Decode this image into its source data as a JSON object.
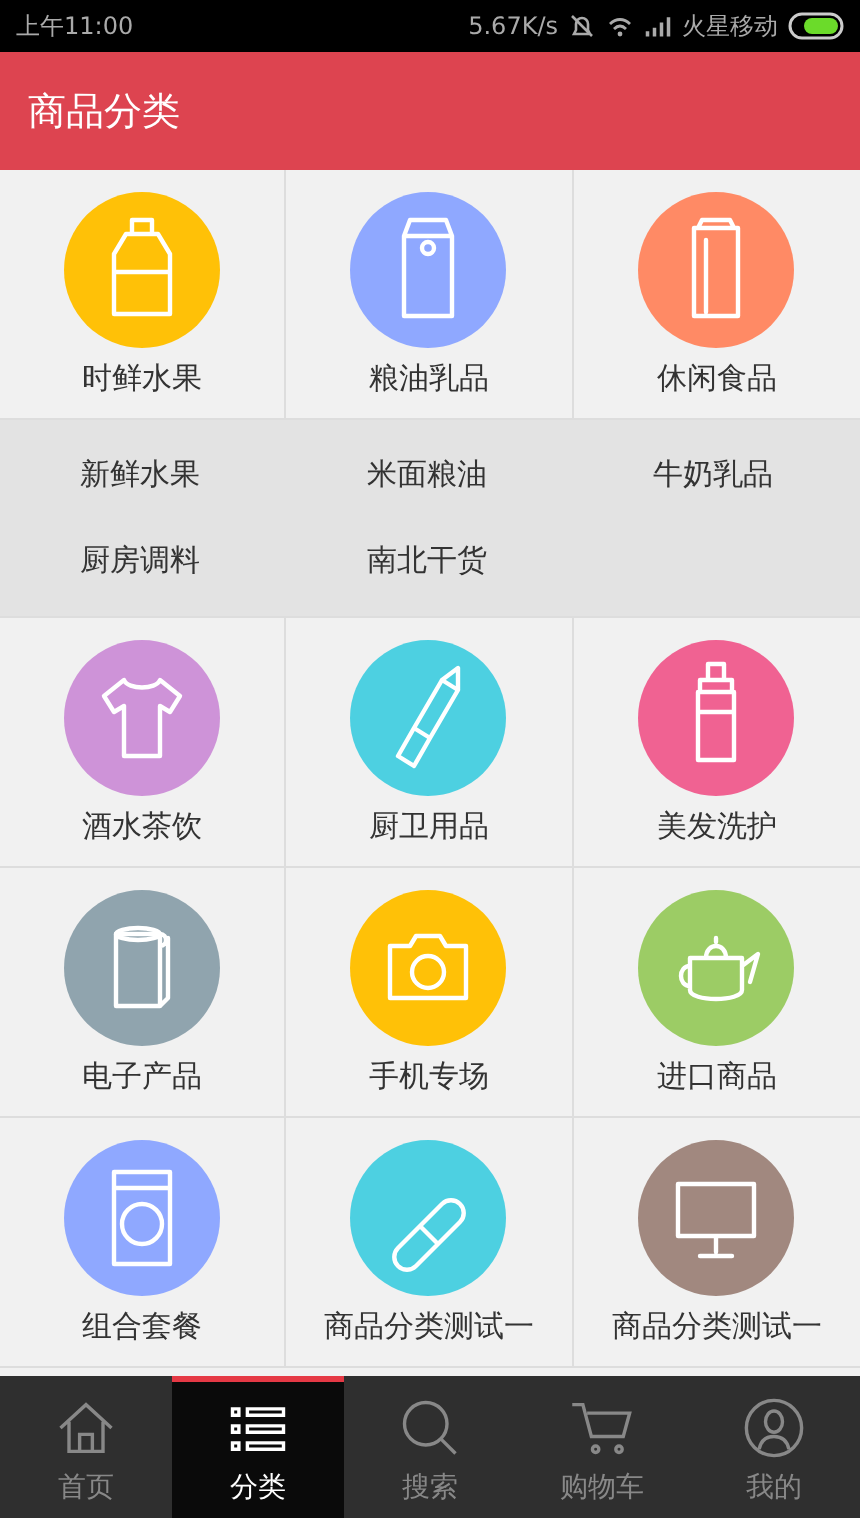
{
  "status_bar": {
    "time": "上午11:00",
    "speed": "5.67K/s",
    "carrier": "火星移动"
  },
  "header": {
    "title": "商品分类"
  },
  "sections": [
    {
      "categories": [
        {
          "label": "时鲜水果",
          "color": "#ffc107"
        },
        {
          "label": "粮油乳品",
          "color": "#8fa8ff"
        },
        {
          "label": "休闲食品",
          "color": "#ff8a65"
        }
      ],
      "subcategories": [
        "新鲜水果",
        "米面粮油",
        "牛奶乳品",
        "厨房调料",
        "南北干货"
      ]
    },
    {
      "categories": [
        {
          "label": "酒水茶饮",
          "color": "#ce93d8"
        },
        {
          "label": "厨卫用品",
          "color": "#4dd0e1"
        },
        {
          "label": "美发洗护",
          "color": "#f06292"
        }
      ]
    },
    {
      "categories": [
        {
          "label": "电子产品",
          "color": "#90a4ae"
        },
        {
          "label": "手机专场",
          "color": "#ffc107"
        },
        {
          "label": "进口商品",
          "color": "#9ccc65"
        }
      ]
    },
    {
      "categories": [
        {
          "label": "组合套餐",
          "color": "#8fa8ff"
        },
        {
          "label": "商品分类测试一",
          "color": "#4dd0e1"
        },
        {
          "label": "商品分类测试一",
          "color": "#a1887f"
        }
      ]
    }
  ],
  "tabs": [
    {
      "label": "首页",
      "selected": false
    },
    {
      "label": "分类",
      "selected": true
    },
    {
      "label": "搜索",
      "selected": false
    },
    {
      "label": "购物车",
      "selected": false
    },
    {
      "label": "我的",
      "selected": false
    }
  ]
}
